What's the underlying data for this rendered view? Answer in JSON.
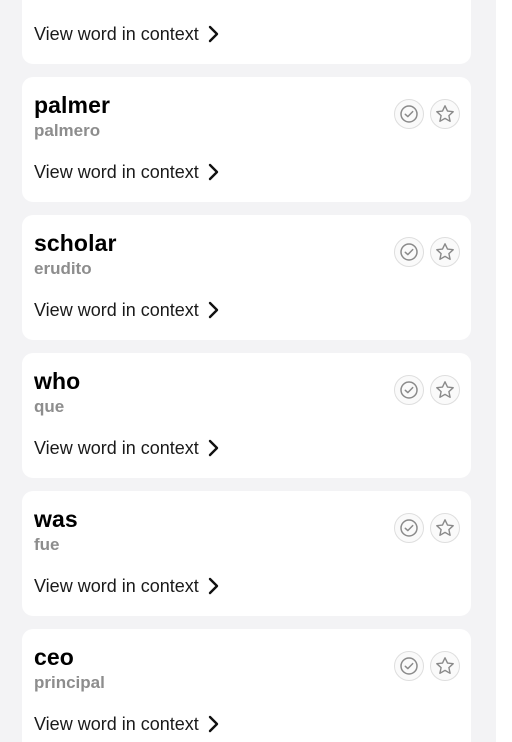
{
  "context_label": "View word in context",
  "cards": [
    {
      "word": "",
      "translation": ""
    },
    {
      "word": "palmer",
      "translation": "palmero"
    },
    {
      "word": "scholar",
      "translation": "erudito"
    },
    {
      "word": "who",
      "translation": "que"
    },
    {
      "word": "was",
      "translation": "fue"
    },
    {
      "word": "ceo",
      "translation": "principal"
    }
  ],
  "icons": {
    "known": "check-circle-icon",
    "favorite": "star-icon",
    "context": "chevron-right-icon"
  },
  "colors": {
    "page_background": "#f3f3f5",
    "card_background": "#ffffff",
    "word": "#000000",
    "translation": "#8d8d8d",
    "icon": "#8a8a8a"
  }
}
